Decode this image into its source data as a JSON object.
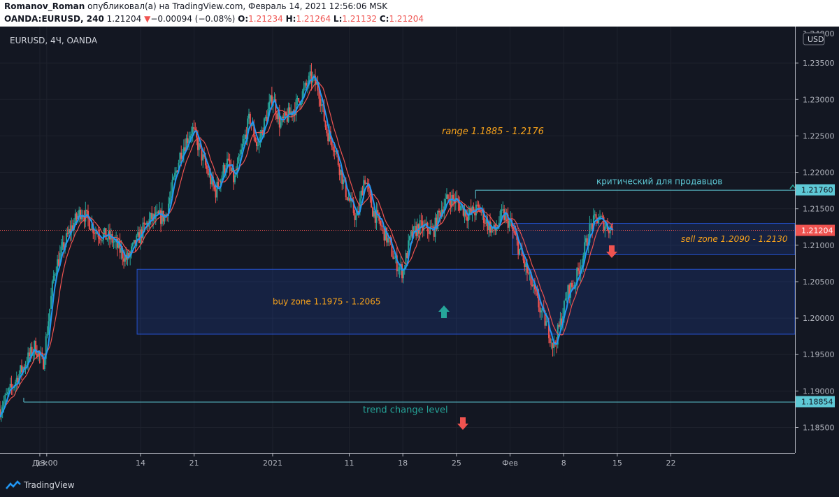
{
  "header": {
    "author": "Romanov_Roman",
    "published": "опубликовал(а) на TradingView.com, Февраль 14, 2021 12:56:06 MSK",
    "symbol_line": "OANDA:EURUSD, 240",
    "last": "1.21204",
    "change_arrow": "▼",
    "change": "−0.00094 (−0.08%)",
    "o_label": "O:",
    "o": "1.21234",
    "h_label": "H:",
    "h": "1.21264",
    "l_label": "L:",
    "l": "1.21132",
    "c_label": "C:",
    "c": "1.21204"
  },
  "footer": {
    "brand": "TradingView"
  },
  "colors": {
    "bg": "#131722",
    "up": "#26a69a",
    "down": "#ef5350",
    "ema_fast": "#2196f3",
    "ema_slow": "#ef5350",
    "zone": "#2962ff",
    "orange": "#f7a21b",
    "cyan": "#5ec9d6",
    "axis_text": "#b2b5be"
  },
  "chart_data": {
    "type": "candlestick",
    "title": "EURUSD, 4Ч, OANDA",
    "currency": "USD",
    "ylim": [
      1.1815,
      1.24
    ],
    "y_ticks": [
      "1.18500",
      "1.19000",
      "1.19500",
      "1.20000",
      "1.20500",
      "1.21000",
      "1.21500",
      "1.22000",
      "1.22500",
      "1.23000",
      "1.23500"
    ],
    "y_top_partial": "1.24000",
    "x_ticks": [
      "Дек",
      "13:00",
      "14",
      "21",
      "2021",
      "11",
      "18",
      "25",
      "Фев",
      "8",
      "15",
      "22"
    ],
    "x_tick_days": [
      0.6,
      1.5,
      13.75,
      20.75,
      31,
      41,
      48,
      55,
      62,
      69,
      76,
      83
    ],
    "x_range_days": [
      -4.6,
      99.2
    ],
    "price_path": [
      [
        -4.6,
        1.1875
      ],
      [
        -2.0,
        1.1925
      ],
      [
        0.0,
        1.1962
      ],
      [
        1.0,
        1.1935
      ],
      [
        2.5,
        1.2065
      ],
      [
        4.5,
        1.212
      ],
      [
        6.0,
        1.2148
      ],
      [
        8.0,
        1.2118
      ],
      [
        10.0,
        1.2108
      ],
      [
        12.0,
        1.208
      ],
      [
        14.0,
        1.212
      ],
      [
        15.0,
        1.2135
      ],
      [
        17.0,
        1.214
      ],
      [
        19.0,
        1.2228
      ],
      [
        20.5,
        1.226
      ],
      [
        22.0,
        1.2215
      ],
      [
        23.5,
        1.2172
      ],
      [
        25.0,
        1.2215
      ],
      [
        26.0,
        1.2188
      ],
      [
        28.0,
        1.2275
      ],
      [
        29.0,
        1.2235
      ],
      [
        31.0,
        1.2305
      ],
      [
        32.0,
        1.2265
      ],
      [
        34.0,
        1.229
      ],
      [
        36.0,
        1.233
      ],
      [
        37.0,
        1.2315
      ],
      [
        38.0,
        1.2258
      ],
      [
        39.0,
        1.2238
      ],
      [
        40.5,
        1.2175
      ],
      [
        42.0,
        1.2135
      ],
      [
        43.0,
        1.2195
      ],
      [
        44.0,
        1.215
      ],
      [
        46.0,
        1.2108
      ],
      [
        47.0,
        1.2078
      ],
      [
        48.0,
        1.2063
      ],
      [
        49.0,
        1.211
      ],
      [
        50.0,
        1.2125
      ],
      [
        52.0,
        1.212
      ],
      [
        53.0,
        1.215
      ],
      [
        54.0,
        1.2165
      ],
      [
        55.0,
        1.216
      ],
      [
        56.5,
        1.2142
      ],
      [
        58.0,
        1.215
      ],
      [
        59.0,
        1.213
      ],
      [
        60.0,
        1.2118
      ],
      [
        61.0,
        1.2143
      ],
      [
        62.0,
        1.213
      ],
      [
        63.0,
        1.21
      ],
      [
        64.0,
        1.207
      ],
      [
        65.0,
        1.204
      ],
      [
        66.0,
        1.201
      ],
      [
        67.0,
        1.1985
      ],
      [
        67.7,
        1.196
      ],
      [
        68.5,
        1.199
      ],
      [
        69.5,
        1.2035
      ],
      [
        70.5,
        1.205
      ],
      [
        71.5,
        1.2085
      ],
      [
        72.5,
        1.2125
      ],
      [
        73.5,
        1.2138
      ],
      [
        74.5,
        1.2127
      ],
      [
        75.5,
        1.2122
      ]
    ],
    "last_price": 1.21204,
    "ema_fast_lag": 0.7,
    "ema_slow_lag": 1.8,
    "zones": [
      {
        "name": "buy",
        "label": "buy zone 1.1975 - 1.2065",
        "from_day": 13.3,
        "to_day": 99.2,
        "low": 1.1978,
        "high": 1.2067
      },
      {
        "name": "sell",
        "label": "sell zone 1.2090 - 1.2130",
        "from_day": 62.3,
        "to_day": 99.2,
        "low": 1.2087,
        "high": 1.213
      }
    ],
    "levels": [
      {
        "name": "critical",
        "label": "критический для продавцов",
        "price": 1.2176,
        "from_day": 57.5,
        "price_label": "1.21760"
      },
      {
        "name": "trend",
        "label": "trend change level",
        "price": 1.18854,
        "from_day": -1.5,
        "price_label": "1.18854"
      }
    ],
    "annotations": [
      {
        "name": "range",
        "text": "range 1.1885 - 1.2176"
      }
    ],
    "current_label": "1.21204"
  }
}
